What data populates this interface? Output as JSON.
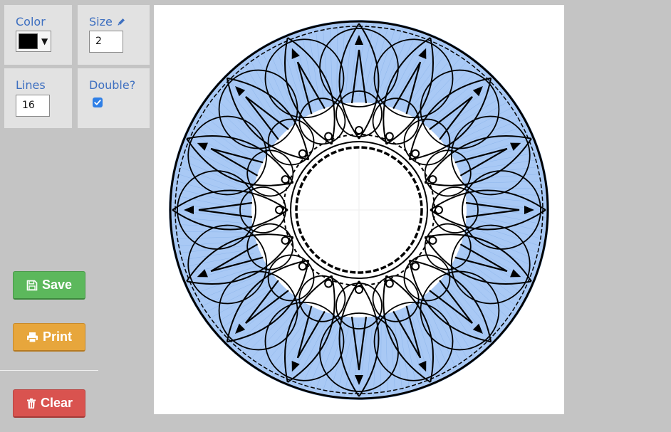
{
  "controls": {
    "color": {
      "label": "Color",
      "value": "#000000",
      "dropdown_icon": "caret-down-icon"
    },
    "size": {
      "label": "Size",
      "icon": "pencil-icon",
      "value": "2"
    },
    "lines": {
      "label": "Lines",
      "value": "16"
    },
    "double": {
      "label": "Double?",
      "checked": true
    }
  },
  "actions": {
    "save": {
      "label": "Save",
      "icon": "floppy-disk-icon",
      "color": "#5cb85c"
    },
    "print": {
      "label": "Print",
      "icon": "printer-icon",
      "color": "#e7a63c"
    },
    "clear": {
      "label": "Clear",
      "icon": "trash-icon",
      "color": "#d9534f"
    }
  },
  "canvas": {
    "stroke_color": "#000000",
    "fill_color": "#a9c9f5",
    "symmetry_lines": 16
  }
}
